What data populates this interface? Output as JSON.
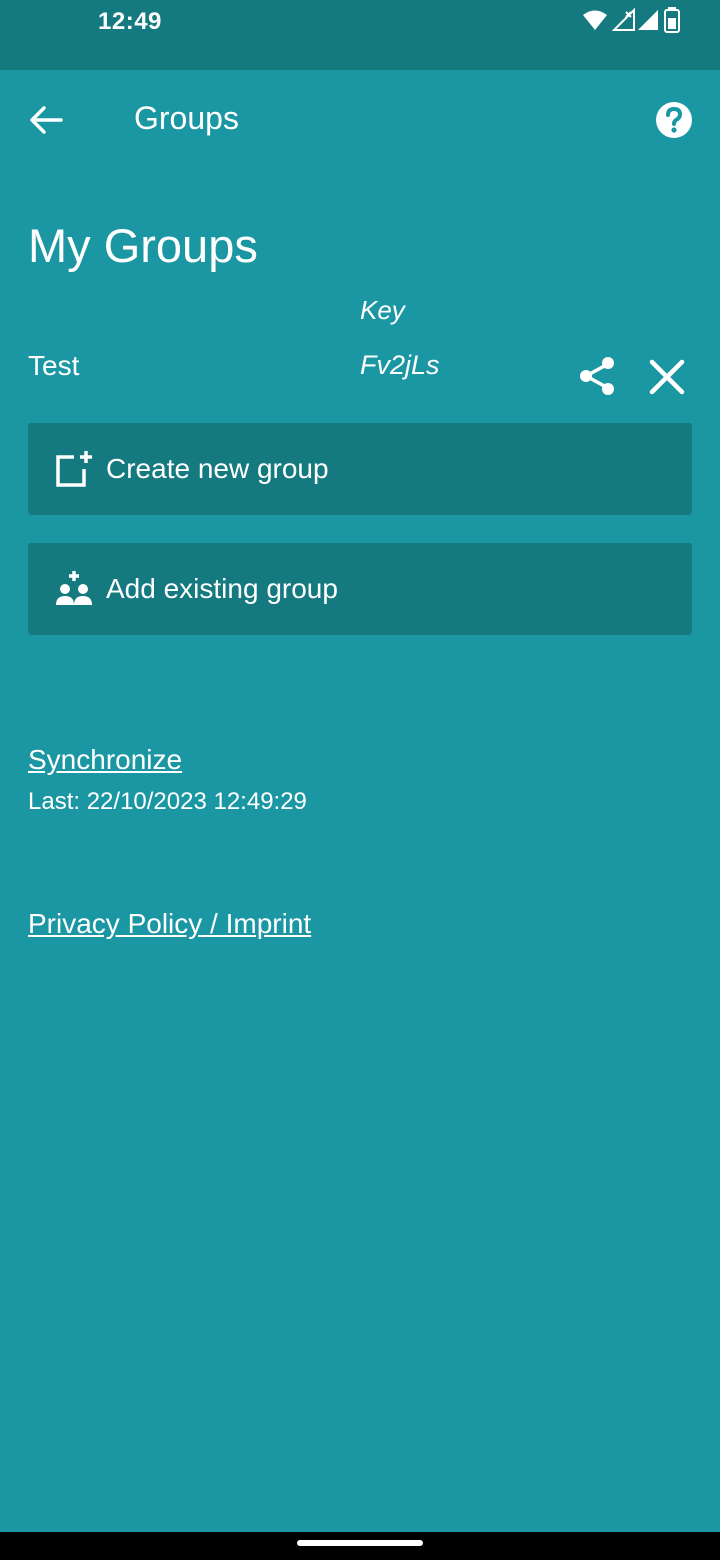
{
  "status_bar": {
    "time": "12:49",
    "icons": [
      "wifi-icon",
      "signal-icon",
      "battery-icon"
    ]
  },
  "app_bar": {
    "title": "Groups",
    "back_icon": "arrow-left-icon",
    "help_icon": "help-circle-icon"
  },
  "page": {
    "title": "My Groups",
    "key_header": "Key"
  },
  "groups": [
    {
      "name": "Test",
      "key": "Fv2jLs",
      "share_icon": "share-icon",
      "remove_icon": "close-icon"
    }
  ],
  "actions": {
    "create_label": "Create new group",
    "add_label": "Add existing group"
  },
  "sync": {
    "link_label": "Synchronize",
    "last_label": "Last: 22/10/2023 12:49:29"
  },
  "privacy": {
    "link_label": "Privacy Policy / Imprint"
  },
  "colors": {
    "background": "#1b97a3",
    "status_bar": "#157a80",
    "button": "#157a80",
    "text": "#ffffff"
  }
}
